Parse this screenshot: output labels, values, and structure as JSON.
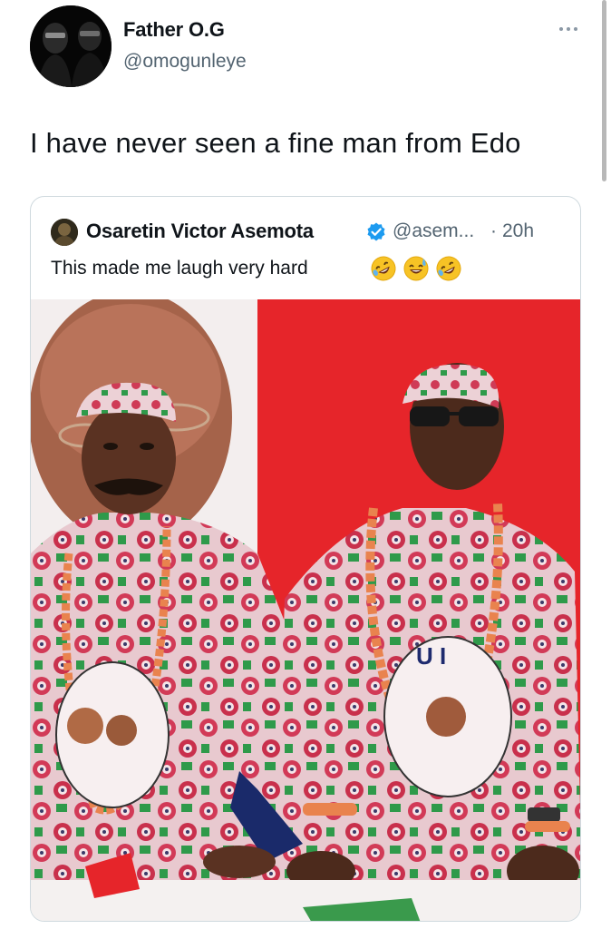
{
  "author": {
    "name": "Father O.G",
    "handle": "@omogunleye"
  },
  "tweet": {
    "text": "I have never seen a fine man from Edo"
  },
  "quoted": {
    "name": "Osaretin Victor Asemota",
    "handle": "@asem...",
    "separator": "·",
    "time": "20h",
    "text": "This made me laugh very hard",
    "emojis": [
      "rolling-on-floor-laughing-emoji",
      "grinning-sweat-emoji",
      "rolling-on-floor-laughing-emoji"
    ],
    "media": {
      "banner_letters": "U I",
      "poster_color": "#e52a2e"
    }
  },
  "icons": {
    "more": "more-horizontal-icon",
    "verified": "verified-badge-icon"
  },
  "colors": {
    "secondary_text": "#536471",
    "verified_blue": "#1d9bf0",
    "card_border": "#cfd9de"
  }
}
